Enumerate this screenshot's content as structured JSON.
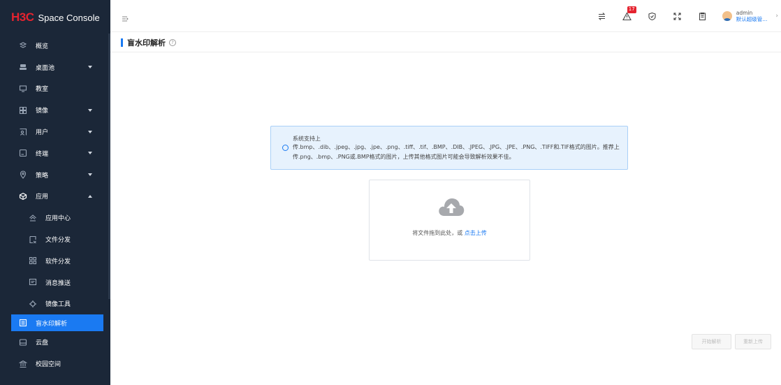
{
  "brand": {
    "logo": "H3C",
    "title": "Space Console"
  },
  "sidebar": {
    "items": [
      {
        "label": "概览",
        "icon": "overview-icon",
        "has_arrow": false
      },
      {
        "label": "桌面池",
        "icon": "desktop-pool-icon",
        "has_arrow": true
      },
      {
        "label": "教室",
        "icon": "classroom-icon",
        "has_arrow": false
      },
      {
        "label": "镜像",
        "icon": "image-icon",
        "has_arrow": true
      },
      {
        "label": "用户",
        "icon": "user-icon",
        "has_arrow": true
      },
      {
        "label": "终端",
        "icon": "terminal-icon",
        "has_arrow": true
      },
      {
        "label": "策略",
        "icon": "policy-icon",
        "has_arrow": true
      },
      {
        "label": "应用",
        "icon": "app-icon",
        "has_arrow": true,
        "expanded": true
      }
    ],
    "sub_items": [
      {
        "label": "应用中心",
        "icon": "app-center-icon"
      },
      {
        "label": "文件分发",
        "icon": "file-distribution-icon"
      },
      {
        "label": "软件分发",
        "icon": "software-distribution-icon"
      },
      {
        "label": "消息推送",
        "icon": "message-push-icon"
      },
      {
        "label": "镜像工具",
        "icon": "image-tool-icon"
      },
      {
        "label": "盲水印解析",
        "icon": "watermark-icon",
        "active": true
      }
    ],
    "extra_items": [
      {
        "label": "云盘",
        "icon": "cloud-disk-icon"
      },
      {
        "label": "校园空间",
        "icon": "campus-space-icon"
      }
    ]
  },
  "topbar": {
    "alarm_count": "17",
    "user_name": "admin",
    "user_role": "默认超级管...",
    "colors": {
      "accent": "#1a7af2",
      "badge": "#e5232f",
      "sidebar": "#1b2738"
    }
  },
  "page": {
    "title": "盲水印解析",
    "info_title": "系统支持上",
    "info_desc": "传.bmp、.dib、.jpeg、.jpg、.jpe、.png、.tiff、.tif、.BMP、.DIB、.JPEG、.JPG、.JPE、.PNG、.TIFF和.TIF格式的图片。推荐上传.png、.bmp、.PNG或.BMP格式的图片，上传其他格式图片可能会导致解析效果不佳。",
    "upload_text": "将文件拖到此处，或 ",
    "upload_link": "点击上传",
    "btn_parse": "开始解析",
    "btn_reupload": "重新上传"
  }
}
